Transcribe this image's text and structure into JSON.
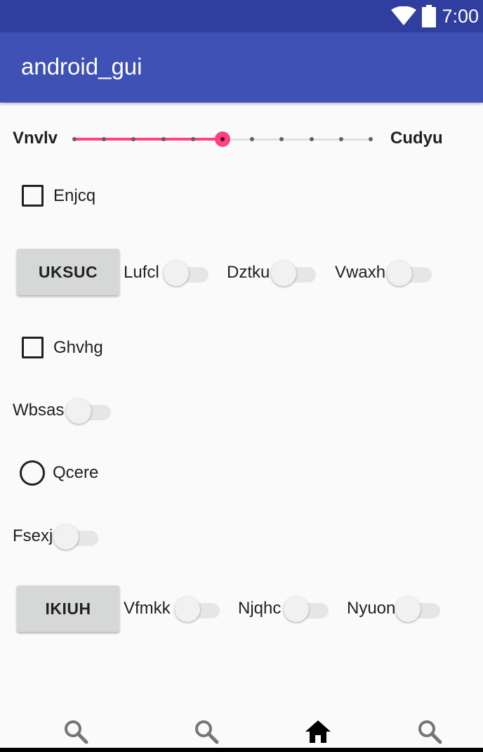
{
  "status_bar": {
    "time": "7:00",
    "icons": [
      "wifi-icon",
      "battery-icon"
    ]
  },
  "app_bar": {
    "title": "android_gui"
  },
  "slider": {
    "min_label": "Vnvlv",
    "max_label": "Cudyu",
    "steps": 10,
    "value": 5
  },
  "checkbox_1": {
    "label": "Enjcq",
    "checked": false
  },
  "row_1": {
    "button_label": "UKSUC",
    "switches": [
      {
        "label": "Lufcl",
        "on": false
      },
      {
        "label": "Dztku",
        "on": false
      },
      {
        "label": "Vwaxh",
        "on": false
      }
    ]
  },
  "checkbox_2": {
    "label": "Ghvhg",
    "checked": false
  },
  "switch_wbsas": {
    "label": "Wbsas",
    "on": false
  },
  "radio_1": {
    "label": "Qcere",
    "checked": false
  },
  "switch_fsexj": {
    "label": "Fsexj",
    "on": false
  },
  "row_2": {
    "button_label": "IKIUH",
    "switches": [
      {
        "label": "Vfmkk",
        "on": false
      },
      {
        "label": "Njqhc",
        "on": false
      },
      {
        "label": "Nyuon",
        "on": false
      }
    ]
  },
  "bottom_nav": {
    "items": [
      {
        "icon": "search-icon"
      },
      {
        "icon": "search-icon"
      },
      {
        "icon": "home-icon",
        "selected": true
      },
      {
        "icon": "search-icon"
      }
    ]
  },
  "colors": {
    "status_bar": "#303f9f",
    "app_bar": "#3f51b5",
    "accent": "#ff4081",
    "background": "#fafafa"
  }
}
